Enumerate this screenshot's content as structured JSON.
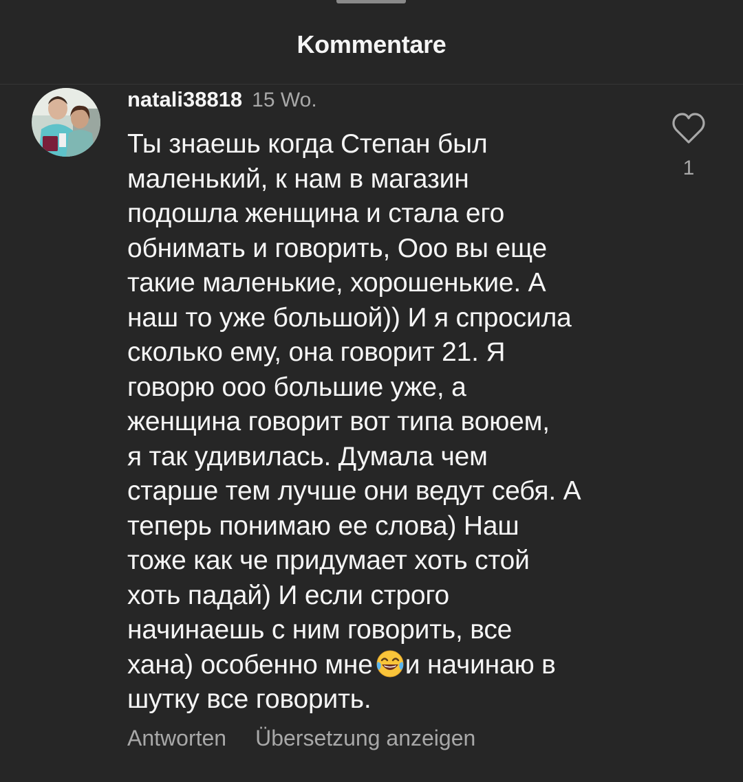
{
  "header": {
    "title": "Kommentare"
  },
  "comment": {
    "username": "natali38818",
    "timestamp": "15 Wo.",
    "text_before_emoji": "Ты знаешь когда Степан был\nмаленький, к нам в магазин\nподошла женщина и стала его\nобнимать и говорить, Ооо вы еще\nтакие маленькие, хорошенькие. А\nнаш то уже большой)) И я спросила\nсколько ему, она говорит 21. Я\nговорю ооо большие уже, а\nженщина говорит вот типа воюем,\nя так удивилась. Думала чем\nстарше тем лучше они ведут себя. А\nтеперь понимаю ее слова) Наш\nтоже как че придумает хоть стой\nхоть падай) И если строго\nначинаешь с ним говорить, все\nхана) особенно мне",
    "emoji": "face-with-tears-of-joy",
    "text_after_emoji": "и начинаю в\nшутку все говорить.",
    "like_count": "1"
  },
  "actions": {
    "reply_label": "Antworten",
    "translate_label": "Übersetzung anzeigen"
  },
  "icons": {
    "like": "heart-outline-icon",
    "avatar": "user-avatar"
  },
  "colors": {
    "background": "#262626",
    "primary_text": "#f5f5f5",
    "secondary_text": "#a8a8a8",
    "divider": "#363636"
  }
}
